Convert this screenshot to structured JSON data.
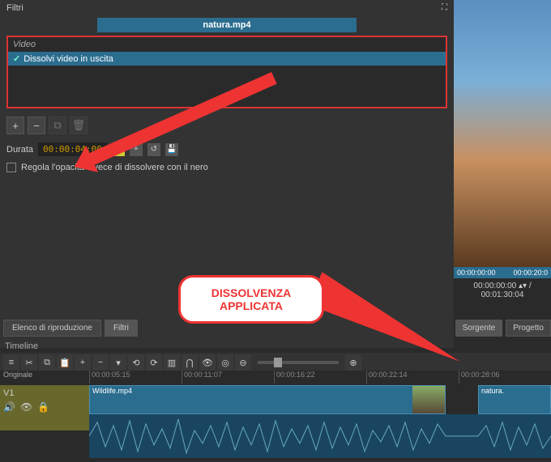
{
  "filters": {
    "panel_title": "Filtri",
    "clip_name": "natura.mp4",
    "group_label": "Video",
    "active_filter": "Dissolvi video in uscita",
    "duration_label": "Durata",
    "duration_value": "00:00:04:00",
    "opacity_checkbox_label": "Regola l'opacità invece di dissolvere con il nero"
  },
  "preview": {
    "time_start": "00:00:00:00",
    "time_end": "00:00:20:0",
    "current_time": "00:00:00:00",
    "total_time": "/ 00:01:30:04",
    "tab_source": "Sorgente",
    "tab_project": "Progetto"
  },
  "bottom_tabs": {
    "playlist": "Elenco di riproduzione",
    "filters": "Filtri"
  },
  "timeline": {
    "header": "Timeline",
    "ruler_label": "Originale",
    "ticks": [
      "00:00:05:15",
      "00:00:11:07",
      "00:00:16:22",
      "00:00:22:14",
      "00:00:28:06"
    ],
    "track_v1": "V1",
    "clip1_name": "Wildlife.mp4",
    "clip2_name": "natura."
  },
  "annotation": {
    "callout_line1": "DISSOLVENZA",
    "callout_line2": "APPLICATA"
  },
  "icons": {
    "popup": "⛶",
    "plus": "+",
    "minus": "−",
    "copy": "⧉",
    "trash": "🗑",
    "undo": "↺",
    "save": "💾",
    "menu": "≡",
    "cut": "✂",
    "clipboard": "📋",
    "down": "▾",
    "back": "⟲",
    "forward": "⟳",
    "cols": "▥",
    "magnet": "⋂",
    "eye": "👁",
    "target": "◎",
    "zoomout": "⊖",
    "zoomin": "⊕",
    "speaker": "🔊",
    "lock": "🔒"
  }
}
